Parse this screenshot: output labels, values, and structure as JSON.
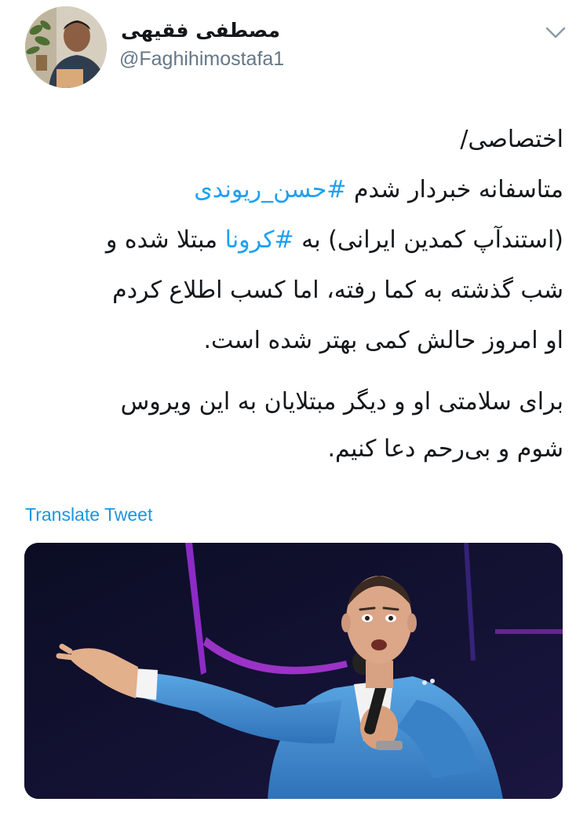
{
  "tweet": {
    "author": {
      "display_name": "مصطفی فقیهی",
      "handle": "@Faghihimostafa1"
    },
    "menu_icon": "chevron-down-icon",
    "text": {
      "line1": "اختصاصی/",
      "line2_prefix": "متاسفانه خبردار شدم ",
      "hashtag1": "#حسن_ریوندی",
      "line3_prefix": "(استندآپ کمدین ایرانی) به ",
      "hashtag2": "#کرونا",
      "line3_suffix": " مبتلا شده و",
      "line4": "شب گذشته به کما رفته، اما کسب اطلاع کردم",
      "line5": "او امروز حالش کمی بهتر شده است.",
      "paragraph2_line1": "برای سلامتی او و دیگر مبتلایان به این ویروس",
      "paragraph2_line2": "شوم و بی‌رحم دعا کنیم."
    },
    "translate_label": "Translate Tweet",
    "colors": {
      "link": "#1da1f2",
      "secondary_text": "#657786",
      "primary_text": "#14171a",
      "suit": "#3f8fd2",
      "stage_background": "#10132e",
      "stage_light": "#a02bd8"
    }
  }
}
